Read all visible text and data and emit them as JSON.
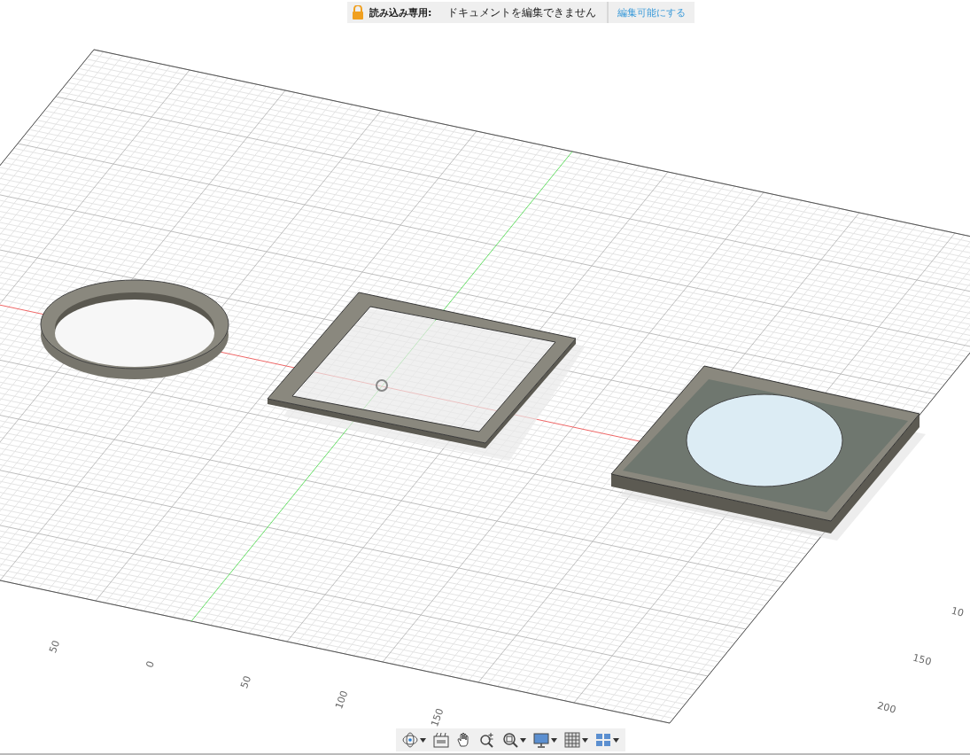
{
  "banner": {
    "label": "読み込み専用:",
    "message": "ドキュメントを編集できません",
    "action": "編集可能にする"
  },
  "axis_labels": [
    {
      "kind": "near",
      "text": "50"
    },
    {
      "kind": "near",
      "text": "0"
    },
    {
      "kind": "near",
      "text": "50"
    },
    {
      "kind": "near",
      "text": "100"
    },
    {
      "kind": "near",
      "text": "150"
    },
    {
      "kind": "right",
      "text": "10"
    },
    {
      "kind": "right",
      "text": "150"
    },
    {
      "kind": "right",
      "text": "200"
    }
  ],
  "toolbar": [
    {
      "kind": "orbit",
      "menu": true
    },
    {
      "kind": "look",
      "menu": false
    },
    {
      "kind": "pan",
      "menu": false
    },
    {
      "kind": "zoom-fit",
      "menu": false
    },
    {
      "kind": "zoom",
      "menu": true
    },
    {
      "kind": "display",
      "menu": true
    },
    {
      "kind": "grid",
      "menu": true
    },
    {
      "kind": "viewports",
      "menu": true
    }
  ]
}
